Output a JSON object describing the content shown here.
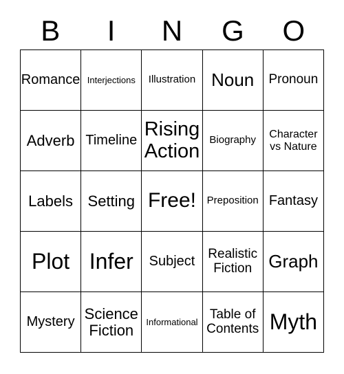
{
  "header": {
    "letters": [
      "B",
      "I",
      "N",
      "G",
      "O"
    ]
  },
  "grid": {
    "rows": 5,
    "columns": 5,
    "border_color": "#000000",
    "background_color": "#ffffff",
    "text_color": "#000000",
    "cells": [
      {
        "text": "Romance",
        "size": "sz-m2",
        "lines": 1
      },
      {
        "text": "Interjections",
        "size": "sz-xs",
        "lines": 1
      },
      {
        "text": "Illustration",
        "size": "sz-s",
        "lines": 1
      },
      {
        "text": "Noun",
        "size": "sz-xl",
        "lines": 1
      },
      {
        "text": "Pronoun",
        "size": "sz-m",
        "lines": 1
      },
      {
        "text": "Adverb",
        "size": "sz-l",
        "lines": 1
      },
      {
        "text": "Timeline",
        "size": "sz-m2",
        "lines": 1
      },
      {
        "text": "Rising\nAction",
        "size": "sz-xxl",
        "lines": 2
      },
      {
        "text": "Biography",
        "size": "sz-s",
        "lines": 1
      },
      {
        "text": "Character\nvs Nature",
        "size": "sz-s2",
        "lines": 2
      },
      {
        "text": "Labels",
        "size": "sz-l",
        "lines": 1
      },
      {
        "text": "Setting",
        "size": "sz-l",
        "lines": 1
      },
      {
        "text": "Free!",
        "size": "sz-h",
        "lines": 1
      },
      {
        "text": "Preposition",
        "size": "sz-s",
        "lines": 1
      },
      {
        "text": "Fantasy",
        "size": "sz-m2",
        "lines": 1
      },
      {
        "text": "Plot",
        "size": "sz-h2",
        "lines": 1
      },
      {
        "text": "Infer",
        "size": "sz-h2",
        "lines": 1
      },
      {
        "text": "Subject",
        "size": "sz-m2",
        "lines": 1
      },
      {
        "text": "Realistic\nFiction",
        "size": "sz-m",
        "lines": 2
      },
      {
        "text": "Graph",
        "size": "sz-xl",
        "lines": 1
      },
      {
        "text": "Mystery",
        "size": "sz-m2",
        "lines": 1
      },
      {
        "text": "Science\nFiction",
        "size": "sz-l",
        "lines": 2
      },
      {
        "text": "Informational",
        "size": "sz-xs",
        "lines": 1
      },
      {
        "text": "Table of\nContents",
        "size": "sz-m",
        "lines": 2
      },
      {
        "text": "Myth",
        "size": "sz-h2",
        "lines": 1
      }
    ]
  }
}
